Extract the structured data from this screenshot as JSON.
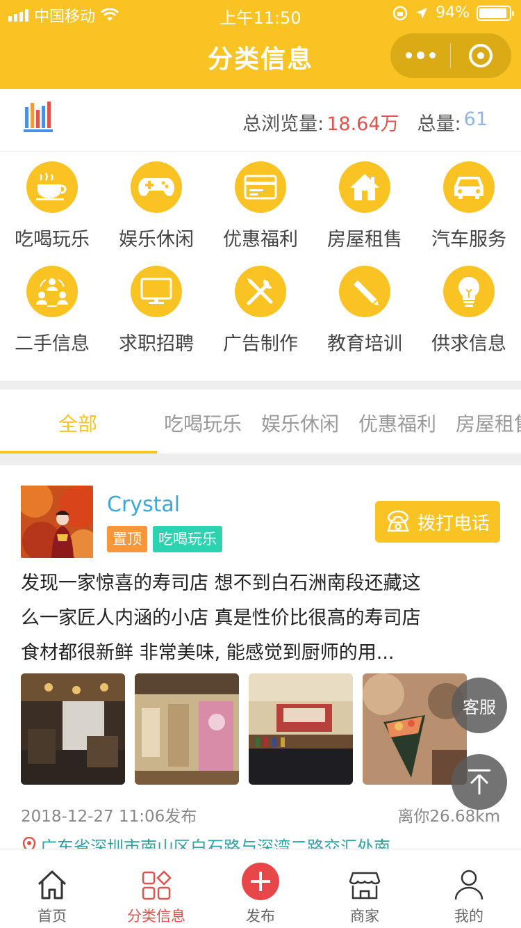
{
  "status_bar": {
    "carrier": "中国移动",
    "time": "上午11:50",
    "battery": "94%",
    "battery_level": 0.94
  },
  "nav": {
    "title": "分类信息"
  },
  "stats": {
    "views_label": "总浏览量:",
    "views_value": "18.64万",
    "total_label": "总量:",
    "total_value": "61"
  },
  "categories": [
    {
      "label": "吃喝玩乐",
      "icon": "coffee-cup-icon"
    },
    {
      "label": "娱乐休闲",
      "icon": "gamepad-icon"
    },
    {
      "label": "优惠福利",
      "icon": "card-icon"
    },
    {
      "label": "房屋租售",
      "icon": "house-icon"
    },
    {
      "label": "汽车服务",
      "icon": "car-icon"
    },
    {
      "label": "二手信息",
      "icon": "people-exchange-icon"
    },
    {
      "label": "求职招聘",
      "icon": "monitor-icon"
    },
    {
      "label": "广告制作",
      "icon": "tools-icon"
    },
    {
      "label": "教育培训",
      "icon": "pencil-icon"
    },
    {
      "label": "供求信息",
      "icon": "lightbulb-icon"
    }
  ],
  "tabs": [
    "全部",
    "吃喝玩乐",
    "娱乐休闲",
    "优惠福利",
    "房屋租售"
  ],
  "post": {
    "username": "Crystal",
    "tag_top": "置顶",
    "tag_category": "吃喝玩乐",
    "call_label": "拨打电话",
    "lines": [
      "发现一家惊喜的寿司店 想不到白石洲南段还藏这",
      "么一家匠人内涵的小店 真是性价比很高的寿司店",
      "食材都很新鲜  非常美味,   能感觉到厨师的用..."
    ],
    "date": "2018-12-27 11:06发布",
    "distance": "离你26.68km",
    "address": "广东省深圳市南山区白石路与深湾二路交汇处南"
  },
  "float_buttons": {
    "service": "客服"
  },
  "tabbar": [
    {
      "label": "首页",
      "icon": "home-icon"
    },
    {
      "label": "分类信息",
      "icon": "category-grid-icon"
    },
    {
      "label": "发布",
      "icon": "plus-icon"
    },
    {
      "label": "商家",
      "icon": "shop-icon"
    },
    {
      "label": "我的",
      "icon": "user-icon"
    }
  ],
  "colors": {
    "brand": "#F8C323",
    "accent_red": "#E2524A",
    "tag_orange": "#F7963A",
    "tag_teal": "#2CD3B0",
    "link_blue": "#3BA7DD"
  }
}
